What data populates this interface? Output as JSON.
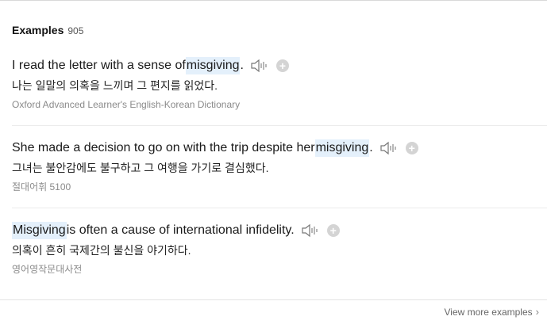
{
  "header": {
    "title": "Examples",
    "count": "905"
  },
  "examples": [
    {
      "before": "I read the letter with a sense of ",
      "highlight": "misgiving",
      "after": ".",
      "translation": "나는 일말의 의혹을 느끼며 그 편지를 읽었다.",
      "source": "Oxford Advanced Learner's English-Korean Dictionary"
    },
    {
      "before": "She made a decision to go on with the trip despite her ",
      "highlight": "misgiving",
      "after": ".",
      "translation": "그녀는 불안감에도 불구하고 그 여행을 가기로 결심했다.",
      "source": "절대어휘 5100"
    },
    {
      "before": "",
      "highlight": "Misgiving",
      "after": " is often a cause of international infidelity.",
      "translation": "의혹이 흔히 국제간의 불신을 야기하다.",
      "source": "영어영작문대사전"
    }
  ],
  "footer": {
    "view_more": "View more examples"
  },
  "icons": {
    "speaker": "speaker-icon",
    "add": "plus-icon",
    "chevron": "chevron-right-icon"
  },
  "colors": {
    "highlight": "#e4f0fb",
    "plus_bg": "#d4d4d4"
  }
}
